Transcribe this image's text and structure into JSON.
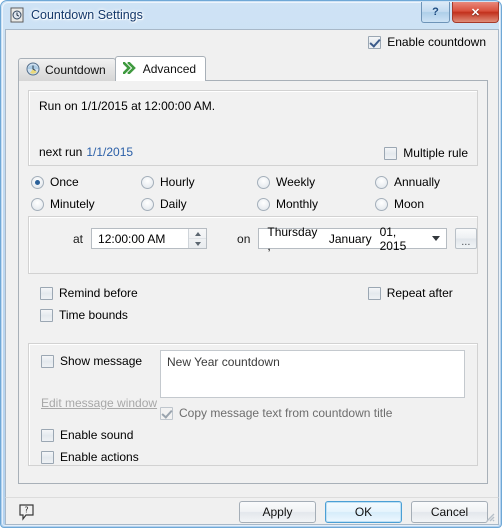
{
  "window": {
    "title": "Countdown Settings",
    "icon": "countdown-app-icon",
    "caption_buttons": {
      "help": "?",
      "close": "✕"
    }
  },
  "enable_countdown": {
    "label": "Enable countdown",
    "checked": true
  },
  "tabs": [
    {
      "label": "Countdown",
      "icon": "globe-clock-icon",
      "active": false
    },
    {
      "label": "Advanced",
      "icon": "double-chevron-icon",
      "active": true
    }
  ],
  "summary": {
    "text": "Run on 1/1/2015 at 12:00:00 AM.",
    "next_run_label": "next run",
    "next_run_value": "1/1/2015",
    "multiple_rule_label": "Multiple rule",
    "multiple_rule_checked": false
  },
  "schedule": {
    "selected": "Once",
    "options": [
      {
        "label": "Once",
        "checked": true
      },
      {
        "label": "Hourly",
        "checked": false
      },
      {
        "label": "Weekly",
        "checked": false
      },
      {
        "label": "Annually",
        "checked": false
      },
      {
        "label": "Minutely",
        "checked": false
      },
      {
        "label": "Daily",
        "checked": false
      },
      {
        "label": "Monthly",
        "checked": false
      },
      {
        "label": "Moon",
        "checked": false
      }
    ]
  },
  "datetime": {
    "at_label": "at",
    "time_value": "12:00:00 AM",
    "on_label": "on",
    "date_weekday": "Thursday ,",
    "date_month": "January",
    "date_day_year": "01, 2015",
    "browse_label": "..."
  },
  "options": {
    "remind_before": {
      "label": "Remind before",
      "checked": false
    },
    "repeat_after": {
      "label": "Repeat after",
      "checked": false
    },
    "time_bounds": {
      "label": "Time bounds",
      "checked": false
    }
  },
  "message": {
    "show_message": {
      "label": "Show message",
      "checked": false
    },
    "edit_window_link": "Edit message window",
    "text_value": "New Year countdown",
    "copy_from_title": {
      "label": "Copy message text from countdown title",
      "checked": true,
      "disabled": true
    }
  },
  "sound": {
    "label": "Enable sound",
    "checked": false
  },
  "actions": {
    "label": "Enable actions",
    "checked": false
  },
  "footer": {
    "help_icon": "help-balloon-icon",
    "apply": "Apply",
    "ok": "OK",
    "cancel": "Cancel"
  },
  "colors": {
    "titlebar_text": "#15396b",
    "link": "#2a5fa8",
    "close_button": "#c2301c",
    "default_button_border": "#4b9fd5",
    "tab_icon_green": "#3f9a3f"
  }
}
